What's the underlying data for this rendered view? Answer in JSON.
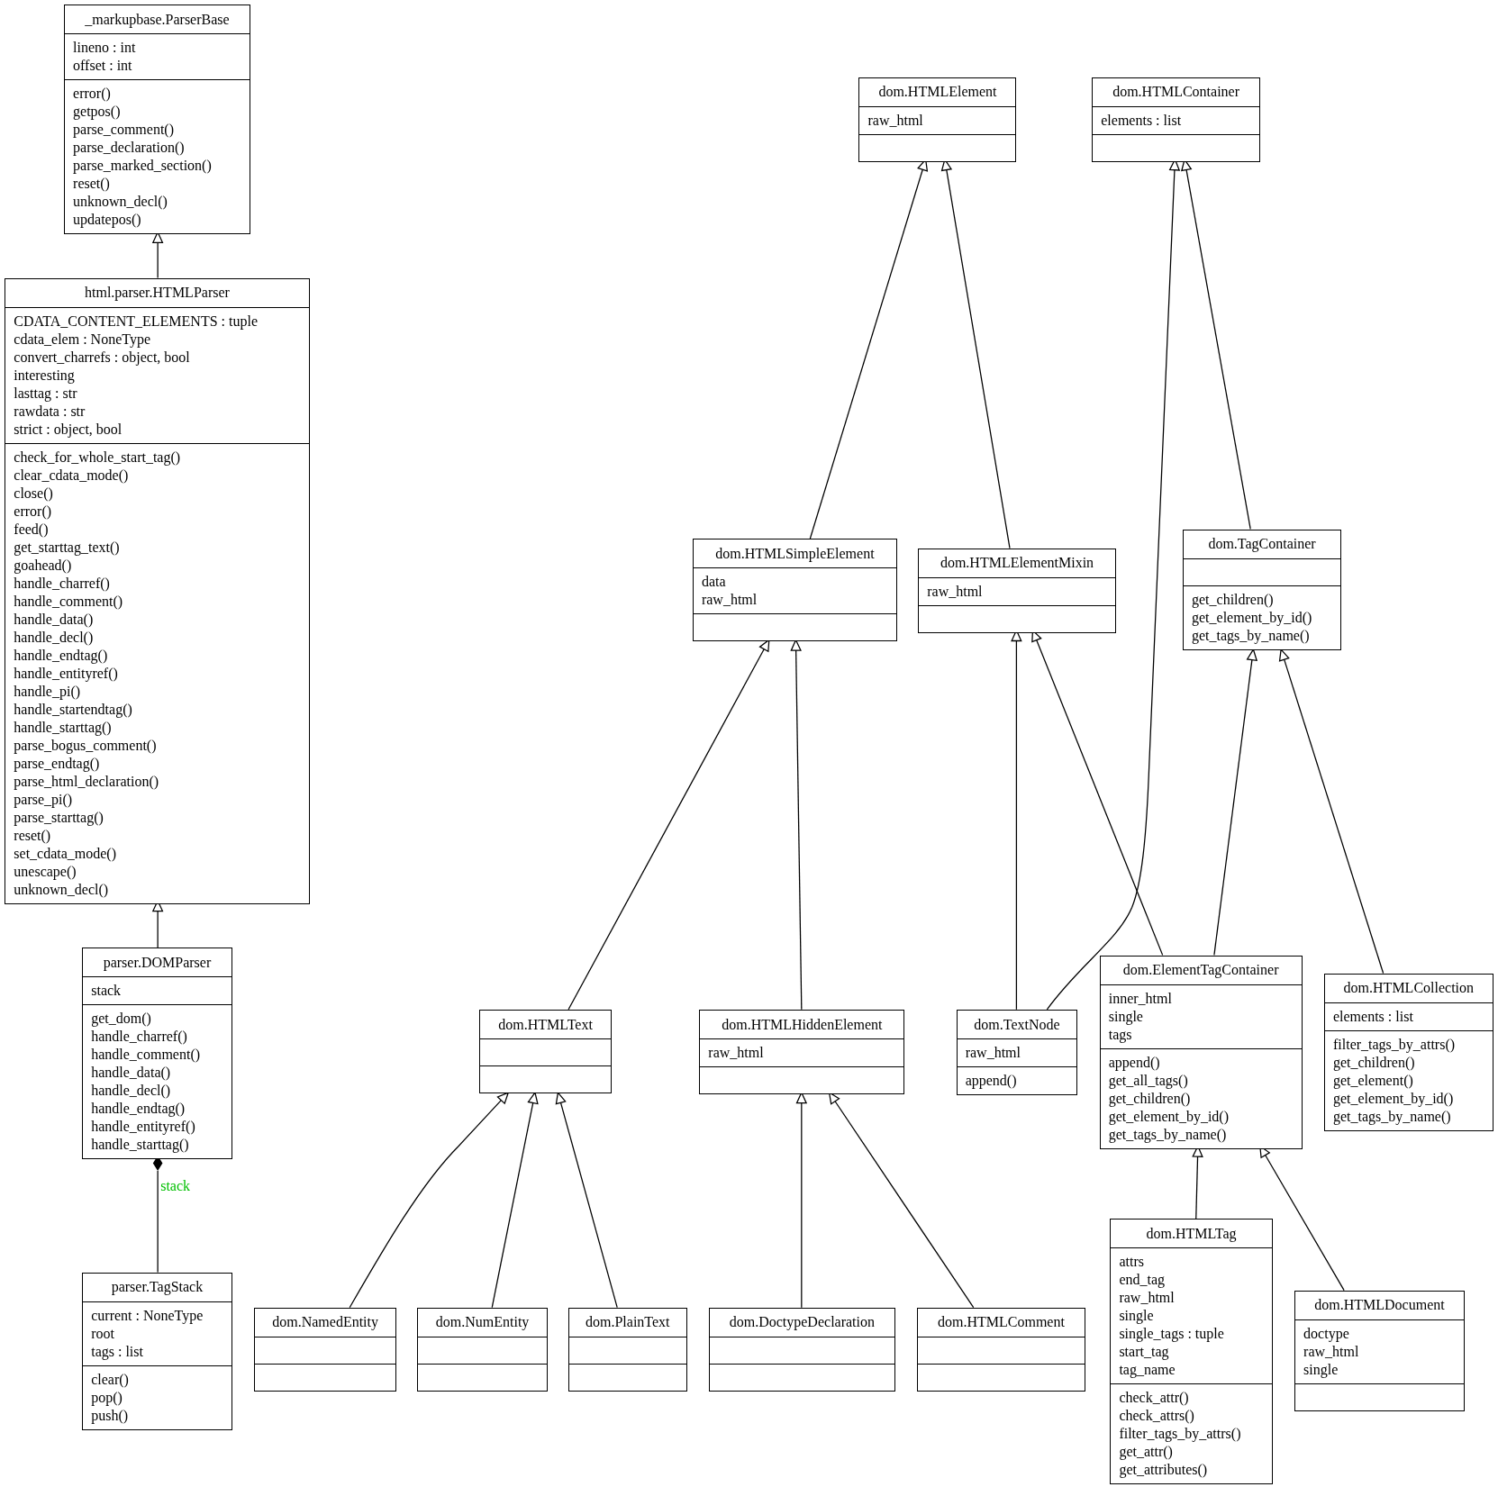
{
  "classes": [
    {
      "name": "_markupbase.ParserBase",
      "attributes": [
        "lineno : int",
        "offset : int"
      ],
      "methods": [
        "error()",
        "getpos()",
        "parse_comment()",
        "parse_declaration()",
        "parse_marked_section()",
        "reset()",
        "unknown_decl()",
        "updatepos()"
      ]
    },
    {
      "name": "html.parser.HTMLParser",
      "attributes": [
        "CDATA_CONTENT_ELEMENTS : tuple",
        "cdata_elem : NoneType",
        "convert_charrefs : object, bool",
        "interesting",
        "lasttag : str",
        "rawdata : str",
        "strict : object, bool"
      ],
      "methods": [
        "check_for_whole_start_tag()",
        "clear_cdata_mode()",
        "close()",
        "error()",
        "feed()",
        "get_starttag_text()",
        "goahead()",
        "handle_charref()",
        "handle_comment()",
        "handle_data()",
        "handle_decl()",
        "handle_endtag()",
        "handle_entityref()",
        "handle_pi()",
        "handle_startendtag()",
        "handle_starttag()",
        "parse_bogus_comment()",
        "parse_endtag()",
        "parse_html_declaration()",
        "parse_pi()",
        "parse_starttag()",
        "reset()",
        "set_cdata_mode()",
        "unescape()",
        "unknown_decl()"
      ]
    },
    {
      "name": "parser.DOMParser",
      "attributes": [
        "stack"
      ],
      "methods": [
        "get_dom()",
        "handle_charref()",
        "handle_comment()",
        "handle_data()",
        "handle_decl()",
        "handle_endtag()",
        "handle_entityref()",
        "handle_starttag()"
      ]
    },
    {
      "name": "parser.TagStack",
      "attributes": [
        "current : NoneType",
        "root",
        "tags : list"
      ],
      "methods": [
        "clear()",
        "pop()",
        "push()"
      ]
    },
    {
      "name": "dom.HTMLElement",
      "attributes": [
        "raw_html"
      ]
    },
    {
      "name": "dom.HTMLContainer",
      "attributes": [
        "elements : list"
      ]
    },
    {
      "name": "dom.HTMLSimpleElement",
      "attributes": [
        "data",
        "raw_html"
      ]
    },
    {
      "name": "dom.HTMLElementMixin",
      "attributes": [
        "raw_html"
      ]
    },
    {
      "name": "dom.TagContainer",
      "methods": [
        "get_children()",
        "get_element_by_id()",
        "get_tags_by_name()"
      ]
    },
    {
      "name": "dom.HTMLText"
    },
    {
      "name": "dom.HTMLHiddenElement",
      "attributes": [
        "raw_html"
      ]
    },
    {
      "name": "dom.TextNode",
      "attributes": [
        "raw_html"
      ],
      "methods": [
        "append()"
      ]
    },
    {
      "name": "dom.ElementTagContainer",
      "attributes": [
        "inner_html",
        "single",
        "tags"
      ],
      "methods": [
        "append()",
        "get_all_tags()",
        "get_children()",
        "get_element_by_id()",
        "get_tags_by_name()"
      ]
    },
    {
      "name": "dom.HTMLCollection",
      "attributes": [
        "elements : list"
      ],
      "methods": [
        "filter_tags_by_attrs()",
        "get_children()",
        "get_element()",
        "get_element_by_id()",
        "get_tags_by_name()"
      ]
    },
    {
      "name": "dom.NamedEntity"
    },
    {
      "name": "dom.NumEntity"
    },
    {
      "name": "dom.PlainText"
    },
    {
      "name": "dom.DoctypeDeclaration"
    },
    {
      "name": "dom.HTMLComment"
    },
    {
      "name": "dom.HTMLTag",
      "attributes": [
        "attrs",
        "end_tag",
        "raw_html",
        "single",
        "single_tags : tuple",
        "start_tag",
        "tag_name"
      ],
      "methods": [
        "check_attr()",
        "check_attrs()",
        "filter_tags_by_attrs()",
        "get_attr()",
        "get_attributes()"
      ]
    },
    {
      "name": "dom.HTMLDocument",
      "attributes": [
        "doctype",
        "raw_html",
        "single"
      ]
    }
  ],
  "association_label": "stack"
}
